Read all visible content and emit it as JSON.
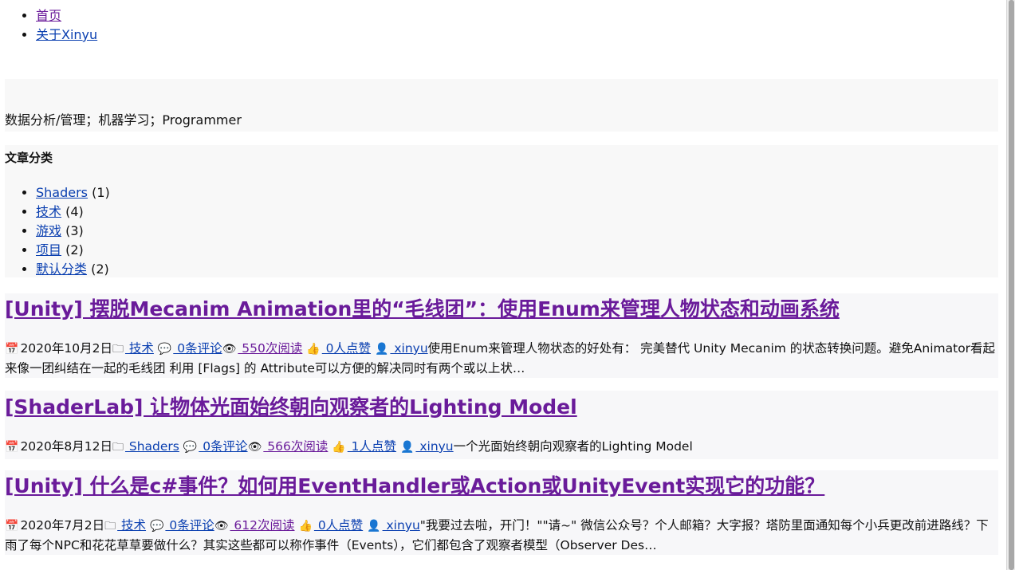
{
  "nav": {
    "items": [
      "首页",
      "关于Xinyu"
    ]
  },
  "tagline": "数据分析/管理；机器学习；Programmer",
  "categories": {
    "heading": "文章分类",
    "items": [
      {
        "label": "Shaders",
        "count": "(1)"
      },
      {
        "label": "技术",
        "count": "(4)"
      },
      {
        "label": "游戏",
        "count": "(3)"
      },
      {
        "label": "项目",
        "count": "(2)"
      },
      {
        "label": "默认分类",
        "count": "(2)"
      }
    ]
  },
  "posts": [
    {
      "title": "[Unity] 摆脱Mecanim Animation里的“毛线团”：使用Enum来管理人物状态和动画系统",
      "date": "2020年10月2日",
      "category": " 技术",
      "comments": " 0条评论",
      "views": " 550次阅读",
      "likes": " 0人点赞",
      "author": " xinyu",
      "excerpt": "使用Enum来管理人物状态的好处有： 完美替代 Unity Mecanim 的状态转换问题。避免Animator看起来像一团纠结在一起的毛线团 利用 [Flags] 的 Attribute可以方便的解决同时有两个或以上状…"
    },
    {
      "title": "[ShaderLab] 让物体光面始终朝向观察者的Lighting Model",
      "date": "2020年8月12日",
      "category": " Shaders",
      "comments": " 0条评论",
      "views": " 566次阅读",
      "likes": " 1人点赞",
      "author": " xinyu",
      "excerpt": "一个光面始终朝向观察者的Lighting Model"
    },
    {
      "title": "[Unity] 什么是c#事件？如何用EventHandler或Action或UnityEvent实现它的功能？",
      "date": "2020年7月2日",
      "category": " 技术",
      "comments": " 0条评论",
      "views": " 612次阅读",
      "likes": " 0人点赞",
      "author": " xinyu",
      "excerpt": "\"我要过去啦，开门！\"\"请~\" 微信公众号？个人邮箱？大字报？塔防里面通知每个小兵更改前进路线？下雨了每个NPC和花花草草要做什么？其实这些都可以称作事件（Events），它们都包含了观察者模型（Observer Des…"
    }
  ],
  "icons": {
    "calendar": "calendar-icon",
    "folder": "folder-icon",
    "comment": "comment-icon",
    "eye": "eye-icon",
    "thumb": "thumb-up-icon",
    "user": "user-icon"
  },
  "colors": {
    "link": "#0a3fb0",
    "visited": "#6a1b9a",
    "panel": "#f8f8f8"
  }
}
